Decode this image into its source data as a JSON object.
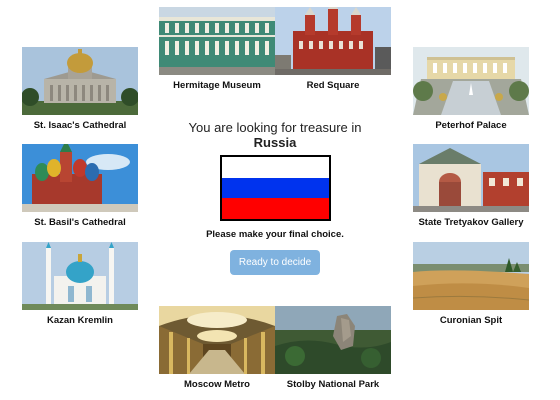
{
  "prompt": {
    "line1": "You are looking for treasure in",
    "country": "Russia",
    "instruction": "Please make your final choice.",
    "button": "Ready to decide"
  },
  "flag": {
    "stripes": [
      "#ffffff",
      "#0033ee",
      "#ff0000"
    ]
  },
  "places": {
    "hermitage": "Hermitage Museum",
    "red_square": "Red Square",
    "st_isaacs": "St. Isaac's Cathedral",
    "peterhof": "Peterhof Palace",
    "st_basils": "St. Basil's Cathedral",
    "tretyakov": "State Tretyakov Gallery",
    "kazan": "Kazan Kremlin",
    "curonian": "Curonian Spit",
    "metro": "Moscow Metro",
    "stolby": "Stolby National Park"
  }
}
